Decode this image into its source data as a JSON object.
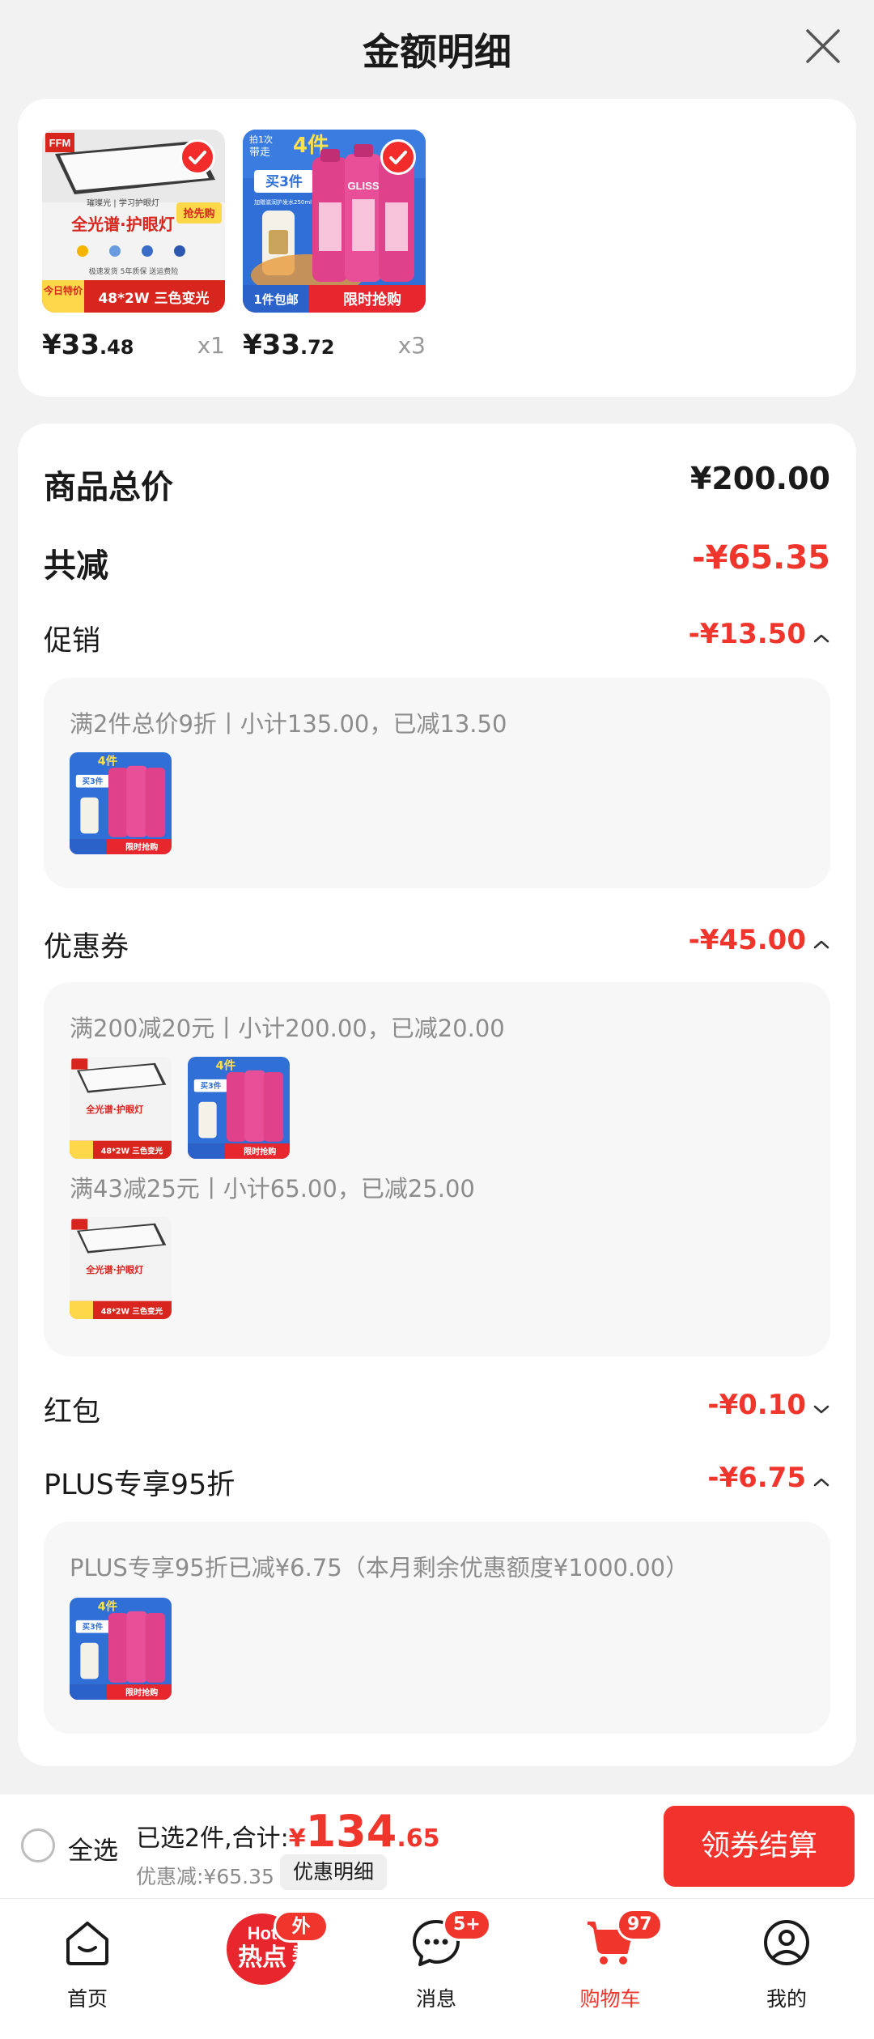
{
  "header": {
    "title": "金额明细"
  },
  "products": [
    {
      "price_int": "¥33",
      "price_dec": ".48",
      "qty": "x1",
      "image": {
        "brand": "FFM",
        "tag_top": "璀璨光 | 学习护眼灯",
        "badge": "抢先购",
        "headline": "全光谱·护眼灯",
        "sub": "极速发货  5年质保  送运费险",
        "bottom_left": "今日特价",
        "bottom_right": "48*2W 三色变光"
      }
    },
    {
      "price_int": "¥33",
      "price_dec": ".72",
      "qty": "x3",
      "image": {
        "top_small": "拍1次",
        "top_small2": "带走",
        "top_big": "4件",
        "buy": "买3件",
        "gift": "加赠滋润护发水250ml",
        "bottom_left": "1件包邮",
        "bottom_right": "限时抢购",
        "bottle_label": "GLISS"
      }
    }
  ],
  "summary": {
    "total_label": "商品总价",
    "total_value": "¥200.00",
    "reduce_label": "共减",
    "reduce_value": "-¥65.35"
  },
  "promotion": {
    "label": "促销",
    "value": "-¥13.50",
    "desc": "满2件总价9折丨小计135.00，已减13.50"
  },
  "coupon": {
    "label": "优惠券",
    "value": "-¥45.00",
    "desc1": "满200减20元丨小计200.00，已减20.00",
    "desc2": "满43减25元丨小计65.00，已减25.00"
  },
  "red_packet": {
    "label": "红包",
    "value": "-¥0.10"
  },
  "plus": {
    "label": "PLUS专享95折",
    "value": "-¥6.75",
    "desc": "PLUS专享95折已减¥6.75（本月剩余优惠额度¥1000.00）"
  },
  "bottom_bar": {
    "select_all": "全选",
    "selected_text": "已选2件,合计:",
    "yen": "¥",
    "total_int": "134",
    "total_dec": ".65",
    "savings": "优惠减:¥65.35",
    "detail_chip": "优惠明细",
    "checkout": "领券结算"
  },
  "tabbar": {
    "home": "首页",
    "hot_badge": "外卖",
    "hot_logo_top": "Hot",
    "hot_logo": "热点",
    "messages": "消息",
    "messages_badge": "5+",
    "cart": "购物车",
    "cart_badge": "97",
    "mine": "我的"
  },
  "colors": {
    "accent_red": "#f0362c",
    "checkout_red": "#f1322d",
    "page_bg": "#f2f2f2",
    "subbox_bg": "#f7f7f7",
    "muted_text": "#8c8c8c"
  }
}
